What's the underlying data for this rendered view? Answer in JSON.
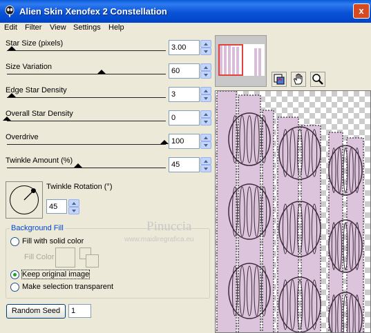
{
  "window": {
    "title": "Alien Skin Xenofex 2 Constellation",
    "close_label": "x"
  },
  "menu": [
    "Edit",
    "Filter",
    "View",
    "Settings",
    "Help"
  ],
  "sliders": [
    {
      "label": "Star Size (pixels)",
      "value": "3.00",
      "fraction": 0.03
    },
    {
      "label": "Size Variation",
      "value": "60",
      "fraction": 0.6
    },
    {
      "label": "Edge Star Density",
      "value": "3",
      "fraction": 0.03
    },
    {
      "label": "Overall Star Density",
      "value": "0",
      "fraction": 0.0
    },
    {
      "label": "Overdrive",
      "value": "100",
      "fraction": 1.0
    },
    {
      "label": "Twinkle Amount (%)",
      "value": "45",
      "fraction": 0.45
    }
  ],
  "twinkle_rotation": {
    "label": "Twinkle Rotation (°)",
    "value": "45"
  },
  "background_fill": {
    "title": "Background Fill",
    "fill_solid_label": "Fill with solid color",
    "fill_color_label": "Fill Color",
    "keep_original_label": "Keep original image",
    "make_transparent_label": "Make selection transparent",
    "selected": "keep_original"
  },
  "random_seed": {
    "button_label": "Random Seed",
    "value": "1"
  },
  "watermark": {
    "name": "Pinuccia",
    "url": "www.maidiregrafica.eu"
  },
  "colors": {
    "preview_fabric": "#dcc4dc",
    "preview_stitch": "#3a2a38",
    "nav_highlight": "#e0413a"
  },
  "icons": {
    "tool_1": "eyedropper-preview-icon",
    "tool_2": "hand-icon",
    "tool_3": "zoom-icon"
  }
}
